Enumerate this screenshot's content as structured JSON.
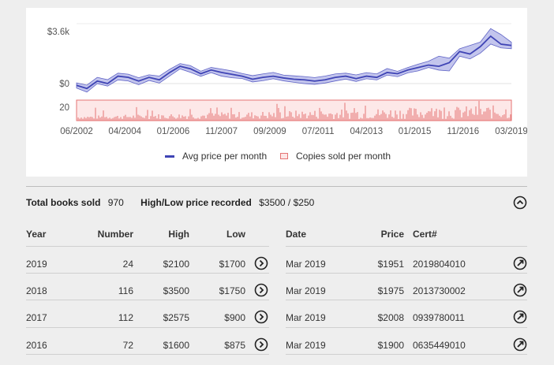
{
  "chart_data": {
    "type": "line",
    "x_ticks": [
      "06/2002",
      "04/2004",
      "01/2006",
      "11/2007",
      "09/2009",
      "07/2011",
      "04/2013",
      "01/2015",
      "11/2016",
      "03/2019"
    ],
    "y_ticks_price": [
      "$3.6k",
      "$0"
    ],
    "y_ticks_copies": [
      "20"
    ],
    "series": [
      {
        "name": "Avg price per month",
        "color": "#3f44b5",
        "values": [
          0.15,
          0.1,
          0.22,
          0.18,
          0.3,
          0.28,
          0.22,
          0.28,
          0.24,
          0.36,
          0.46,
          0.42,
          0.34,
          0.4,
          0.36,
          0.33,
          0.3,
          0.25,
          0.28,
          0.3,
          0.27,
          0.25,
          0.24,
          0.22,
          0.24,
          0.28,
          0.3,
          0.26,
          0.3,
          0.28,
          0.36,
          0.34,
          0.4,
          0.44,
          0.48,
          0.46,
          0.52,
          0.7,
          0.66,
          0.78,
          0.95,
          0.82,
          0.8
        ]
      },
      {
        "name": "Copies sold per month",
        "color": "#e57373"
      }
    ]
  },
  "legend": {
    "avg": "Avg price per month",
    "copies": "Copies sold per month"
  },
  "summary": {
    "total_label": "Total books sold",
    "total_value": "970",
    "hl_label": "High/Low price recorded",
    "hl_value": "$3500 / $250"
  },
  "left_table": {
    "headers": {
      "year": "Year",
      "number": "Number",
      "high": "High",
      "low": "Low"
    },
    "rows": [
      {
        "year": "2019",
        "number": "24",
        "high": "$2100",
        "low": "$1700"
      },
      {
        "year": "2018",
        "number": "116",
        "high": "$3500",
        "low": "$1750"
      },
      {
        "year": "2017",
        "number": "112",
        "high": "$2575",
        "low": "$900"
      },
      {
        "year": "2016",
        "number": "72",
        "high": "$1600",
        "low": "$875"
      }
    ]
  },
  "right_table": {
    "headers": {
      "date": "Date",
      "price": "Price",
      "cert": "Cert#"
    },
    "rows": [
      {
        "date": "Mar 2019",
        "price": "$1951",
        "cert": "2019804010"
      },
      {
        "date": "Mar 2019",
        "price": "$1975",
        "cert": "2013730002"
      },
      {
        "date": "Mar 2019",
        "price": "$2008",
        "cert": "0939780011"
      },
      {
        "date": "Mar 2019",
        "price": "$1900",
        "cert": "0635449010"
      }
    ]
  }
}
